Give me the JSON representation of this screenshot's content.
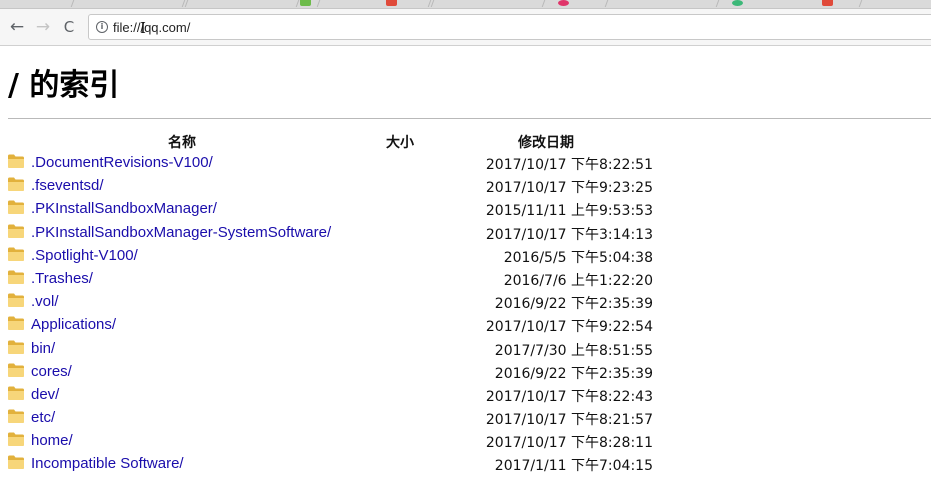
{
  "browser": {
    "back_icon": "←",
    "forward_icon": "→",
    "reload_icon": "C",
    "info_icon": "i",
    "url": "file:///qq.com/",
    "cursor_glyph": "I"
  },
  "page": {
    "title": "/ 的索引",
    "columns": {
      "name": "名称",
      "size": "大小",
      "modified": "修改日期"
    },
    "entries": [
      {
        "name": ".DocumentRevisions-V100/",
        "size": "",
        "modified": "2017/10/17 下午8:22:51"
      },
      {
        "name": ".fseventsd/",
        "size": "",
        "modified": "2017/10/17 下午9:23:25"
      },
      {
        "name": ".PKInstallSandboxManager/",
        "size": "",
        "modified": "2015/11/11 上午9:53:53"
      },
      {
        "name": ".PKInstallSandboxManager-SystemSoftware/",
        "size": "",
        "modified": "2017/10/17 下午3:14:13"
      },
      {
        "name": ".Spotlight-V100/",
        "size": "",
        "modified": "2016/5/5 下午5:04:38"
      },
      {
        "name": ".Trashes/",
        "size": "",
        "modified": "2016/7/6 上午1:22:20"
      },
      {
        "name": ".vol/",
        "size": "",
        "modified": "2016/9/22 下午2:35:39"
      },
      {
        "name": "Applications/",
        "size": "",
        "modified": "2017/10/17 下午9:22:54"
      },
      {
        "name": "bin/",
        "size": "",
        "modified": "2017/7/30 上午8:51:55"
      },
      {
        "name": "cores/",
        "size": "",
        "modified": "2016/9/22 下午2:35:39"
      },
      {
        "name": "dev/",
        "size": "",
        "modified": "2017/10/17 下午8:22:43"
      },
      {
        "name": "etc/",
        "size": "",
        "modified": "2017/10/17 下午8:21:57"
      },
      {
        "name": "home/",
        "size": "",
        "modified": "2017/10/17 下午8:28:11"
      },
      {
        "name": "Incompatible Software/",
        "size": "",
        "modified": "2017/1/11 下午7:04:15"
      }
    ]
  },
  "colors": {
    "link": "#1a0dab",
    "folder_light": "#f7d67a",
    "folder_dark": "#e2b13c"
  }
}
